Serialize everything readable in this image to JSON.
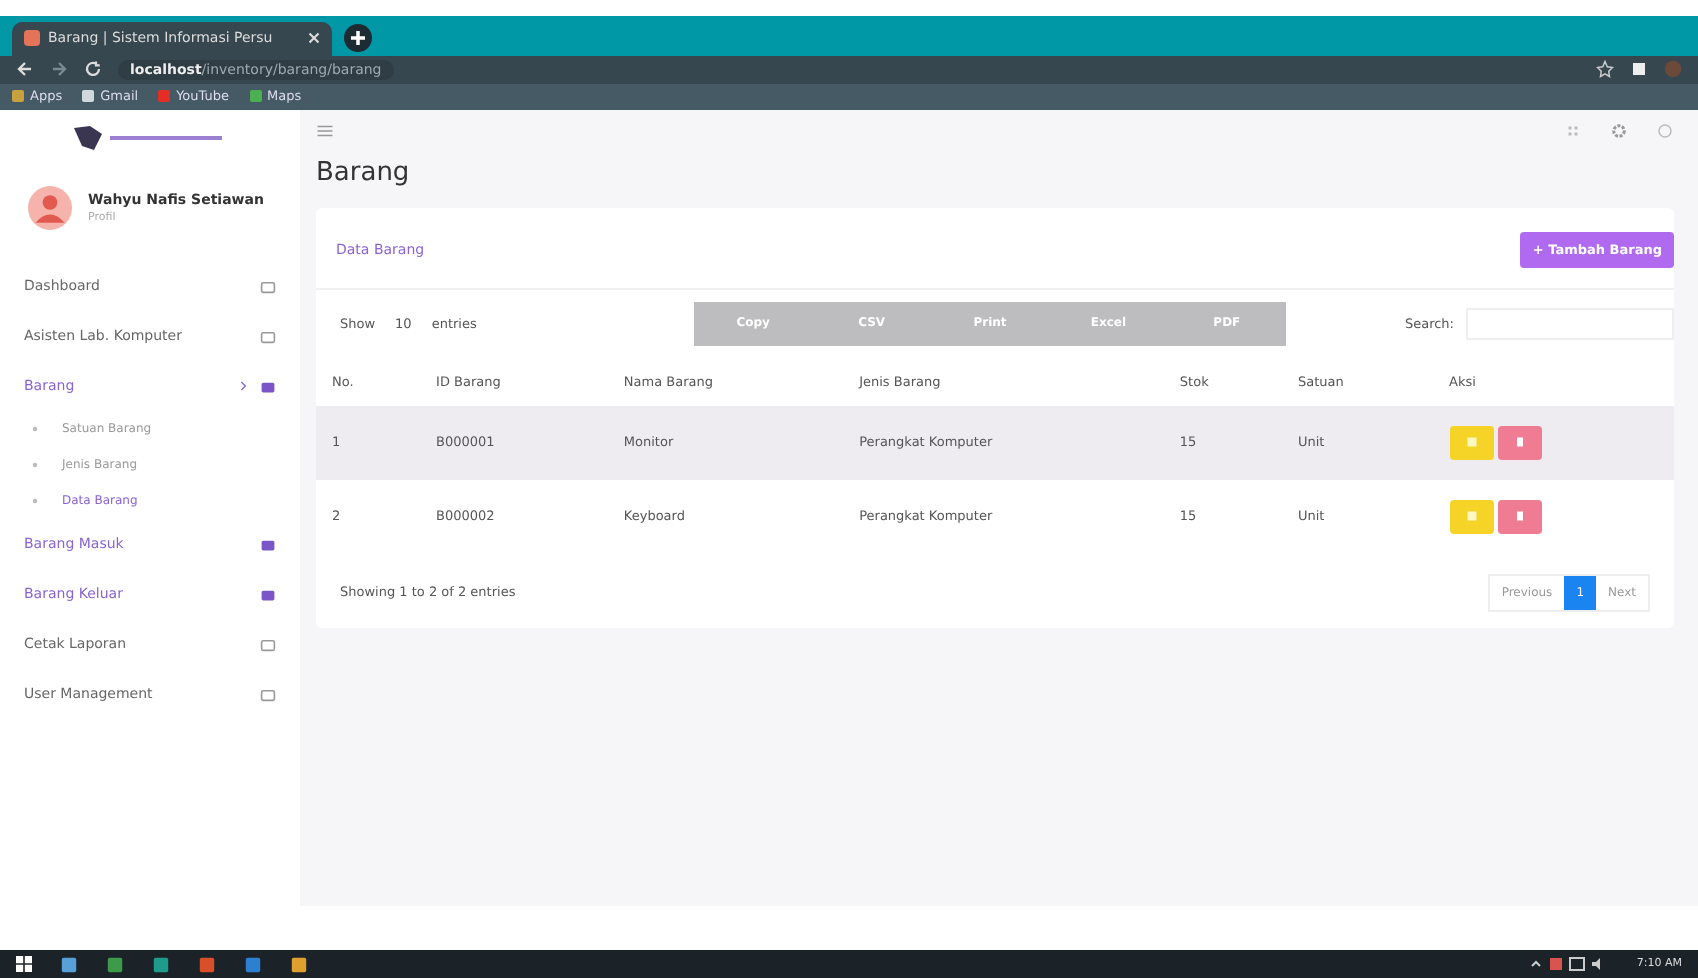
{
  "browser": {
    "tab_title": "Barang | Sistem Informasi Persu",
    "url_host": "localhost",
    "url_path": "/inventory/barang/barang",
    "bookmarks": [
      "Apps",
      "Gmail",
      "YouTube",
      "Maps"
    ]
  },
  "sidebar": {
    "user": {
      "name": "Wahyu Nafis Setiawan",
      "role": "Profil"
    },
    "items": [
      {
        "label": "Dashboard",
        "active": false,
        "expanded": false
      },
      {
        "label": "Asisten Lab. Komputer",
        "active": false,
        "expanded": false
      },
      {
        "label": "Barang",
        "active": true,
        "expanded": true,
        "children": [
          {
            "label": "Satuan Barang",
            "selected": false
          },
          {
            "label": "Jenis Barang",
            "selected": false
          },
          {
            "label": "Data Barang",
            "selected": true
          }
        ]
      },
      {
        "label": "Barang Masuk",
        "active": true,
        "expanded": false
      },
      {
        "label": "Barang Keluar",
        "active": true,
        "expanded": false
      },
      {
        "label": "Cetak Laporan",
        "active": false,
        "expanded": false
      },
      {
        "label": "User Management",
        "active": false,
        "expanded": false
      }
    ]
  },
  "page": {
    "title": "Barang",
    "card_title": "Data Barang",
    "add_button": "+ Tambah Barang",
    "show_label": "Show",
    "entries_value": "10",
    "entries_label": "entries",
    "export_buttons": [
      "Copy",
      "CSV",
      "Print",
      "Excel",
      "PDF"
    ],
    "search_label": "Search:"
  },
  "table": {
    "columns": [
      "No.",
      "ID Barang",
      "Nama Barang",
      "Jenis Barang",
      "Stok",
      "Satuan",
      "Aksi"
    ],
    "rows": [
      [
        "1",
        "B000001",
        "Monitor",
        "Perangkat Komputer",
        "15",
        "Unit"
      ],
      [
        "2",
        "B000002",
        "Keyboard",
        "Perangkat Komputer",
        "15",
        "Unit"
      ]
    ],
    "info": "Showing 1 to 2 of 2 entries",
    "pagination": [
      {
        "label": "Previous",
        "selected": false
      },
      {
        "label": "1",
        "selected": true
      },
      {
        "label": "Next",
        "selected": false
      }
    ]
  },
  "taskbar": {
    "time": "7:10 AM"
  }
}
